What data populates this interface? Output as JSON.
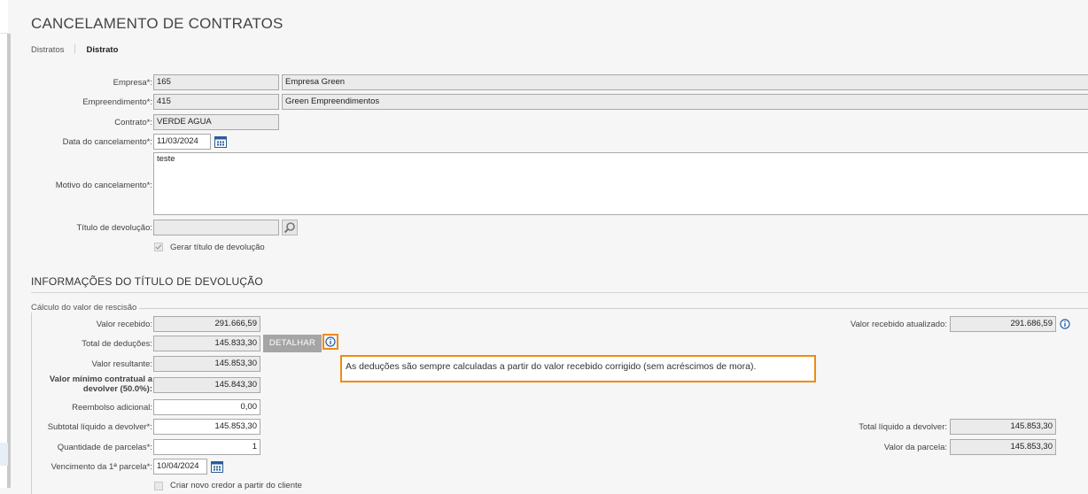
{
  "page": {
    "title": "CANCELAMENTO DE CONTRATOS"
  },
  "breadcrumb": {
    "items": [
      "Distratos",
      "Distrato"
    ]
  },
  "form": {
    "empresa": {
      "label": "Empresa*:",
      "code": "165",
      "name": "Empresa Green"
    },
    "empreendimento": {
      "label": "Empreendimento*:",
      "code": "415",
      "name": "Green Empreendimentos"
    },
    "contrato": {
      "label": "Contrato*:",
      "value": "VERDE AGUA"
    },
    "data_cancelamento": {
      "label": "Data do cancelamento*:",
      "value": "11/03/2024"
    },
    "motivo": {
      "label": "Motivo do cancelamento*:",
      "value": "teste"
    },
    "titulo_devolucao": {
      "label": "Título de devolução:",
      "value": ""
    },
    "gerar_titulo": {
      "label": "Gerar título de devolução",
      "checked": true
    }
  },
  "section": {
    "title": "INFORMAÇÕES DO TÍTULO DE DEVOLUÇÃO",
    "legend": "Cálculo do valor de rescisão"
  },
  "calc": {
    "valor_recebido": {
      "label": "Valor recebido:",
      "value": "291.666,59"
    },
    "total_deducoes": {
      "label": "Total de deduções:",
      "value": "145.833,30"
    },
    "detalhar_button": "DETALHAR",
    "valor_resultante": {
      "label": "Valor resultante:",
      "value": "145.853,30"
    },
    "valor_minimo": {
      "label": "Valor mínimo contratual a devolver (50.0%):",
      "value": "145.843,30"
    },
    "reembolso": {
      "label": "Reembolso adicional:",
      "value": "0,00"
    },
    "subtotal": {
      "label": "Subtotal líquido a devolver*:",
      "value": "145.853,30"
    },
    "qtd_parcelas": {
      "label": "Quantidade de parcelas*:",
      "value": "1"
    },
    "vencimento": {
      "label": "Vencimento da 1ª parcela*:",
      "value": "10/04/2024"
    },
    "criar_credor": {
      "label": "Criar novo credor a partir do cliente",
      "checked": false
    },
    "valor_recebido_atualizado": {
      "label": "Valor recebido atualizado:",
      "value": "291.686,59"
    },
    "total_liquido": {
      "label": "Total líquido a devolver:",
      "value": "145.853,30"
    },
    "valor_parcela": {
      "label": "Valor da parcela:",
      "value": "145.853,30"
    }
  },
  "tooltip": {
    "text": "As deduções são sempre calculadas a partir do valor recebido corrigido (sem acréscimos de mora)."
  },
  "colors": {
    "highlight": "#f08a10",
    "button": "#a5a5a5",
    "accent_icon": "#1f5fa8"
  }
}
